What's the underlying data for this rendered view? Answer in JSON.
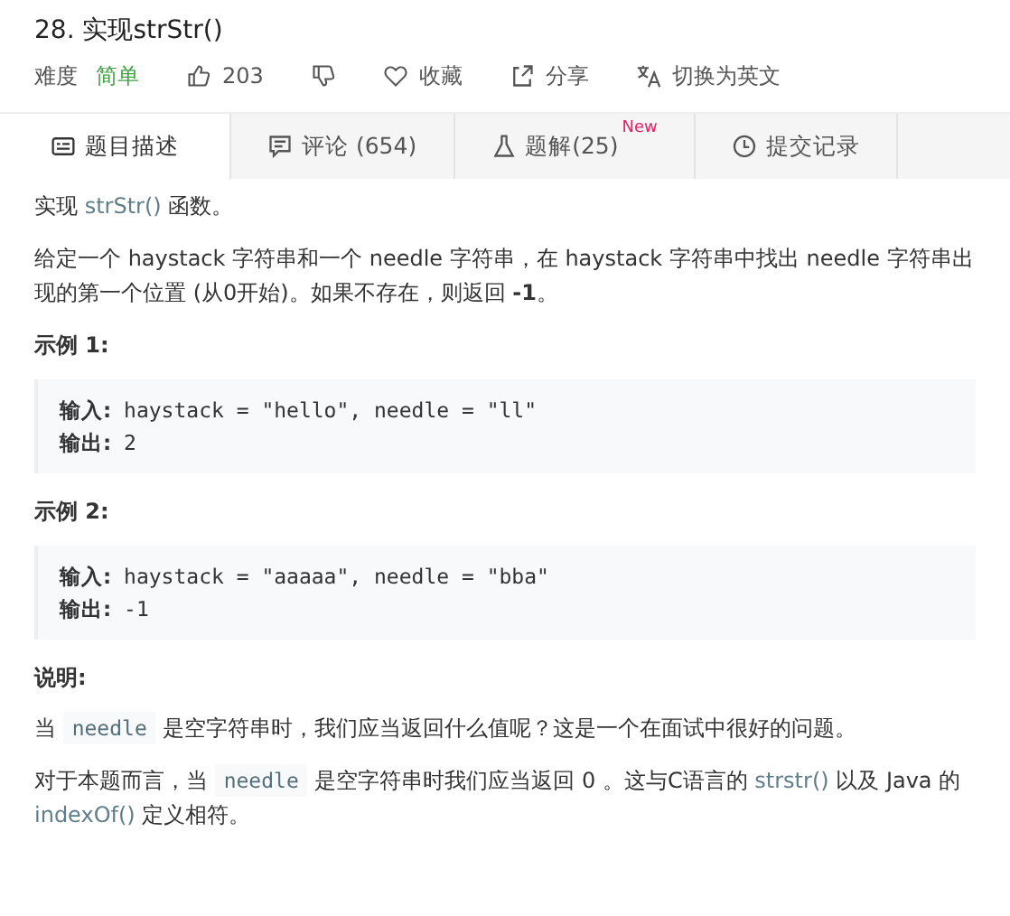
{
  "title": "28. 实现strStr()",
  "meta": {
    "difficulty_label": "难度",
    "difficulty": "简单",
    "likes": "203",
    "favorite": "收藏",
    "share": "分享",
    "switch_language": "切换为英文"
  },
  "tabs": [
    {
      "label": "题目描述",
      "selected": true
    },
    {
      "label": "评论 (654)",
      "selected": false
    },
    {
      "label": "题解(25)",
      "selected": false,
      "badge": "New"
    },
    {
      "label": "提交记录",
      "selected": false
    }
  ],
  "content": [
    {
      "kind": "paragraph",
      "segments": [
        {
          "kind": "text",
          "text": "实现 "
        },
        {
          "kind": "link",
          "text": "strStr()"
        },
        {
          "kind": "text",
          "text": " 函数。"
        }
      ]
    },
    {
      "kind": "paragraph",
      "segments": [
        {
          "kind": "text",
          "text": "给定一个 haystack 字符串和一个 needle 字符串，在 haystack 字符串中找出 needle 字符串出现的第一个位置 (从0开始)。如果不存在，则返回  "
        },
        {
          "kind": "bold",
          "text": "-1"
        },
        {
          "kind": "text",
          "text": "。"
        }
      ]
    },
    {
      "kind": "heading",
      "text": "示例 1:"
    },
    {
      "kind": "example",
      "lines": [
        {
          "label": "输入:",
          "value": " haystack = \"hello\", needle = \"ll\""
        },
        {
          "label": "输出:",
          "value": " 2"
        }
      ]
    },
    {
      "kind": "heading",
      "text": "示例 2:"
    },
    {
      "kind": "example",
      "lines": [
        {
          "label": "输入:",
          "value": " haystack = \"aaaaa\", needle = \"bba\""
        },
        {
          "label": "输出:",
          "value": " -1"
        }
      ]
    },
    {
      "kind": "heading",
      "text": "说明:"
    },
    {
      "kind": "paragraph",
      "segments": [
        {
          "kind": "text",
          "text": "当 "
        },
        {
          "kind": "code",
          "text": "needle"
        },
        {
          "kind": "text",
          "text": " 是空字符串时，我们应当返回什么值呢？这是一个在面试中很好的问题。"
        }
      ]
    },
    {
      "kind": "paragraph",
      "segments": [
        {
          "kind": "text",
          "text": "对于本题而言，当 "
        },
        {
          "kind": "code",
          "text": "needle"
        },
        {
          "kind": "text",
          "text": " 是空字符串时我们应当返回 0 。这与C语言的 "
        },
        {
          "kind": "link",
          "text": "strstr()"
        },
        {
          "kind": "text",
          "text": " 以及 Java 的 "
        },
        {
          "kind": "link",
          "text": "indexOf()"
        },
        {
          "kind": "text",
          "text": " 定义相符。"
        }
      ]
    }
  ]
}
